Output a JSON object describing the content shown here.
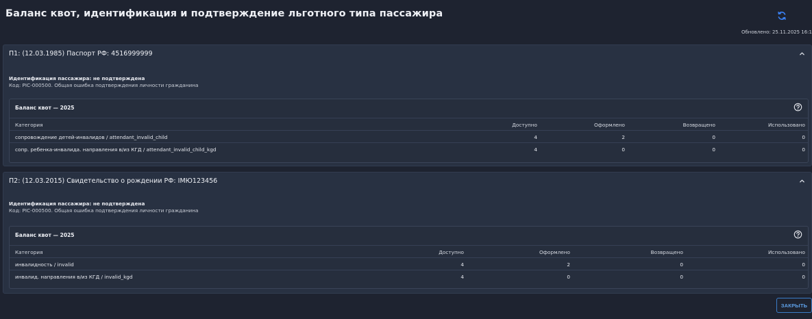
{
  "window": {
    "title": "Баланс квот, идентификация и подтверждение льготного типа пассажира",
    "updated_text": "Обновлено: 25.11.2025 16:1",
    "refresh_icon": "refresh-icon",
    "accent_color": "#3b82f6"
  },
  "passengers": [
    {
      "header": "П1: (12.03.1985) Паспорт РФ: 4516999999",
      "ident_label": "Идентификация пассажира: не подтверждена",
      "ident_code": "Код: PIC-000500. Общая ошибка подтверждения личности гражданина",
      "quota": {
        "title": "Баланс квот — 2025",
        "columns": [
          "Категория",
          "Доступно",
          "Оформлено",
          "Возвращено",
          "Использовано"
        ],
        "rows": [
          {
            "category": "сопровождение детей-инвалидов / attendant_invalid_child",
            "available": "4",
            "issued": "2",
            "returned": "0",
            "used": "0"
          },
          {
            "category": "сопр. ребенка-инвалида. направления в/из КГД / attendant_invalid_child_kgd",
            "available": "4",
            "issued": "0",
            "returned": "0",
            "used": "0"
          }
        ]
      }
    },
    {
      "header": "П2: (12.03.2015) Свидетельство о рождении РФ: IМЮ123456",
      "ident_label": "Идентификация пассажира: не подтверждена",
      "ident_code": "Код: PIC-000500. Общая ошибка подтверждения личности гражданина",
      "quota": {
        "title": "Баланс квот — 2025",
        "columns": [
          "Категория",
          "Доступно",
          "Оформлено",
          "Возвращено",
          "Использовано"
        ],
        "rows": [
          {
            "category": "инвалидность / invalid",
            "available": "4",
            "issued": "2",
            "returned": "0",
            "used": "0"
          },
          {
            "category": "инвалид. направления в/из КГД / invalid_kgd",
            "available": "4",
            "issued": "0",
            "returned": "0",
            "used": "0"
          }
        ]
      }
    }
  ],
  "footer": {
    "close_label": "ЗАКРЫТЬ"
  }
}
